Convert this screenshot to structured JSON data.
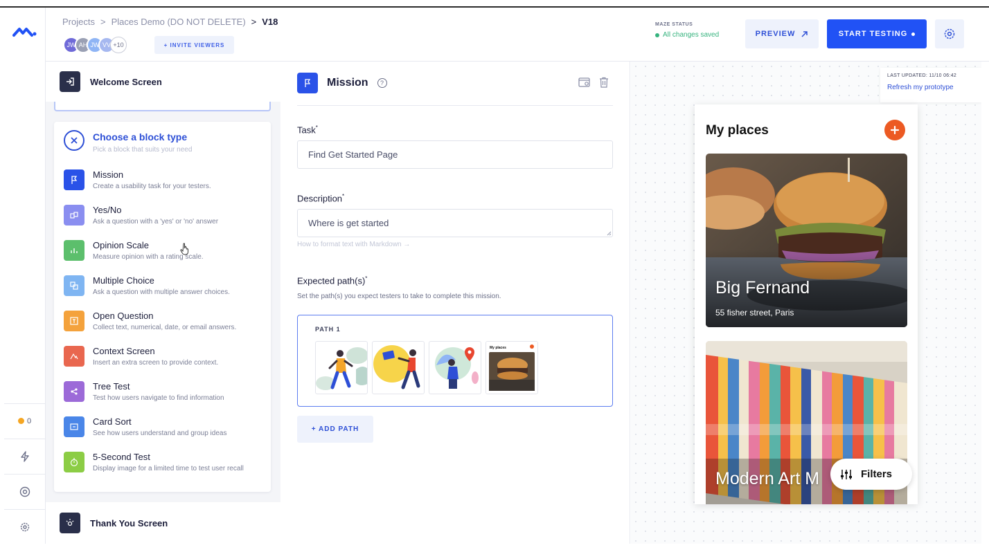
{
  "header": {
    "breadcrumbs": [
      "Projects",
      "Places Demo (DO NOT DELETE)",
      "V18"
    ],
    "avatars": [
      {
        "initials": "JW",
        "color": "#6f6ad8"
      },
      {
        "initials": "AH",
        "color": "#9aa0b4"
      },
      {
        "initials": "JW",
        "color": "#8fb5f5"
      },
      {
        "initials": "VV",
        "color": "#a6b8f0"
      },
      {
        "initials": "+10",
        "color": "#ffffff"
      }
    ],
    "invite_label": "+ INVITE VIEWERS",
    "maze_status_label": "MAZE STATUS",
    "maze_status_value": "All changes saved",
    "preview_label": "PREVIEW",
    "start_label": "START TESTING"
  },
  "rail": {
    "notifications": "0"
  },
  "blocks": {
    "welcome": "Welcome Screen",
    "thankyou": "Thank You Screen",
    "picker_title": "Choose a block type",
    "picker_sub": "Pick a block that suits your need",
    "types": [
      {
        "name": "Mission",
        "desc": "Create a usability task for your testers.",
        "color": "#2a52e8"
      },
      {
        "name": "Yes/No",
        "desc": "Ask a question with a 'yes' or 'no' answer",
        "color": "#8a8ef0"
      },
      {
        "name": "Opinion Scale",
        "desc": "Measure opinion with a rating scale.",
        "color": "#5cbf6c"
      },
      {
        "name": "Multiple Choice",
        "desc": "Ask a question with multiple answer choices.",
        "color": "#7fb5f2"
      },
      {
        "name": "Open Question",
        "desc": "Collect text, numerical, date, or email answers.",
        "color": "#f4a23c"
      },
      {
        "name": "Context Screen",
        "desc": "Insert an extra screen to provide context.",
        "color": "#e9674f"
      },
      {
        "name": "Tree Test",
        "desc": "Test how users navigate to find information",
        "color": "#9c6ad8"
      },
      {
        "name": "Card Sort",
        "desc": "See how users understand and group ideas",
        "color": "#4a86e8"
      },
      {
        "name": "5-Second Test",
        "desc": "Display image for a limited time to test user recall",
        "color": "#8ccd45"
      }
    ]
  },
  "mission": {
    "title": "Mission",
    "task_label": "Task",
    "task_value": "Find Get Started Page",
    "description_label": "Description",
    "description_value": "Where is get started",
    "markdown_hint": "How to format text with Markdown →",
    "paths_label": "Expected path(s)",
    "paths_hint": "Set the path(s) you expect testers to take to complete this mission.",
    "path_name": "PATH 1",
    "add_path_label": "+ ADD PATH"
  },
  "preview": {
    "updated_label": "LAST UPDATED: 11/10 06:42",
    "refresh_label": "Refresh my prototype",
    "screen_title": "My places",
    "card1_name": "Big Fernand",
    "card1_address": "55 fisher street, Paris",
    "card2_name": "Modern Art M",
    "filters_label": "Filters"
  }
}
